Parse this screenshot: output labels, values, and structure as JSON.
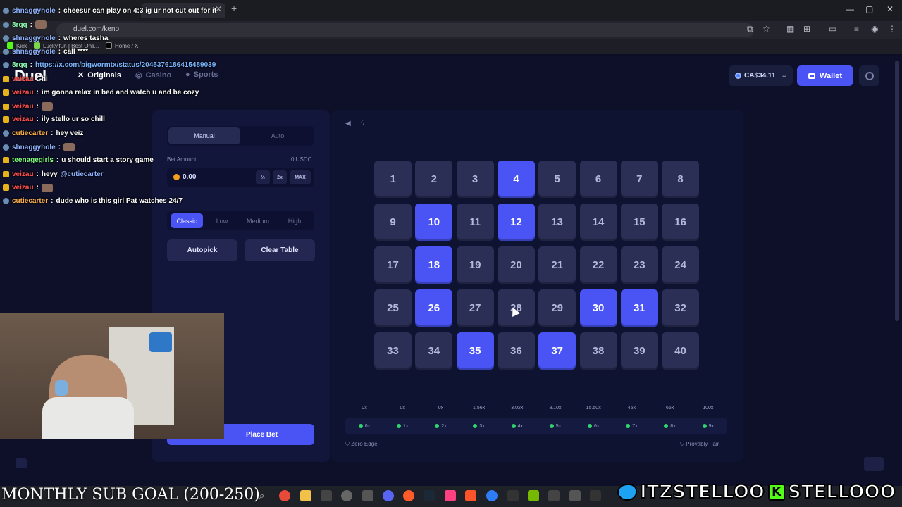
{
  "browser": {
    "url": "duel.com/keno",
    "bookmarks": [
      "Kick",
      "Lucky.fun | Best Onli...",
      "Home / X"
    ]
  },
  "site": {
    "logo": "Duel",
    "nav": [
      {
        "label": "Originals",
        "icon": "crossed-swords-icon"
      },
      {
        "label": "Casino",
        "icon": "casino-chip-icon"
      },
      {
        "label": "Sports",
        "icon": "ball-icon"
      }
    ],
    "balance": "CA$34.11",
    "wallet_label": "Wallet"
  },
  "controls": {
    "modes": [
      "Manual",
      "Auto"
    ],
    "active_mode": "Manual",
    "bet_amount_label": "Bet Amount",
    "bet_currency": "0 USDC",
    "bet_value": "0.00",
    "bet_buttons": [
      "½",
      "2x",
      "MAX"
    ],
    "risk_levels": [
      "Classic",
      "Low",
      "Medium",
      "High"
    ],
    "active_risk": "Classic",
    "autopick_label": "Autopick",
    "clear_label": "Clear Table",
    "place_bet_label": "Place Bet"
  },
  "board": {
    "numbers": [
      1,
      2,
      3,
      4,
      5,
      6,
      7,
      8,
      9,
      10,
      11,
      12,
      13,
      14,
      15,
      16,
      17,
      18,
      19,
      20,
      21,
      22,
      23,
      24,
      25,
      26,
      27,
      28,
      29,
      30,
      31,
      32,
      33,
      34,
      35,
      36,
      37,
      38,
      39,
      40
    ],
    "selected": [
      4,
      10,
      12,
      18,
      26,
      30,
      31,
      35,
      37
    ],
    "accent_color": "#4a54f5"
  },
  "payouts": {
    "multipliers": [
      "0x",
      "0x",
      "0x",
      "1.56x",
      "3.02x",
      "8.10x",
      "15.50x",
      "45x",
      "65x",
      "100x"
    ],
    "hits": [
      "0x",
      "1x",
      "2x",
      "3x",
      "4x",
      "5x",
      "6x",
      "7x",
      "8x",
      "9x"
    ]
  },
  "footer": {
    "zero_edge": "Zero Edge",
    "provably_fair": "Provably Fair"
  },
  "chat": [
    {
      "user": "shnaggyhole",
      "color": "#8fb3ff",
      "badge": "globe",
      "msg": "cheesur can play on 4:3 ig ur not cut out for it"
    },
    {
      "user": "8rqq",
      "color": "#8fffb2",
      "badge": "globe",
      "msg": "",
      "emote": true
    },
    {
      "user": "shnaggyhole",
      "color": "#8fb3ff",
      "badge": "globe",
      "msg": "wheres tasha"
    },
    {
      "user": "shnaggyhole",
      "color": "#8fb3ff",
      "badge": "globe",
      "msg": "call ****"
    },
    {
      "user": "8rqq",
      "color": "#8fffb2",
      "badge": "globe",
      "msg": "https://x.com/bigwormtx/status/2045376186415489039",
      "link": true
    },
    {
      "user": "veizau",
      "color": "#ff4d4d",
      "badge": "sub",
      "msg": "hi"
    },
    {
      "user": "veizau",
      "color": "#ff4d4d",
      "badge": "sub",
      "msg": "im gonna relax in bed and watch u and be cozy"
    },
    {
      "user": "veizau",
      "color": "#ff4d4d",
      "badge": "sub",
      "msg": "",
      "emote": true
    },
    {
      "user": "veizau",
      "color": "#ff4d4d",
      "badge": "sub",
      "msg": "ily stello ur so chill"
    },
    {
      "user": "cutiecarter",
      "color": "#ffb14d",
      "badge": "globe",
      "msg": "hey veiz"
    },
    {
      "user": "shnaggyhole",
      "color": "#8fb3ff",
      "badge": "globe",
      "msg": "",
      "emote": true
    },
    {
      "user": "teenagegirls",
      "color": "#7dff7d",
      "badge": "sub",
      "msg": "u should start a story game"
    },
    {
      "user": "veizau",
      "color": "#ff4d4d",
      "badge": "sub",
      "msg": "heyy",
      "mention": "@cutiecarter"
    },
    {
      "user": "veizau",
      "color": "#ff4d4d",
      "badge": "sub",
      "msg": "",
      "emote": true
    },
    {
      "user": "cutiecarter",
      "color": "#ffb14d",
      "badge": "globe",
      "msg": "dude who is this girl Pat watches 24/7"
    }
  ],
  "overlay": {
    "sub_goal": "MONTHLY SUB GOAL (200-250)",
    "twitter": "ITZSTELLOO",
    "kick": "STELLOOO"
  }
}
